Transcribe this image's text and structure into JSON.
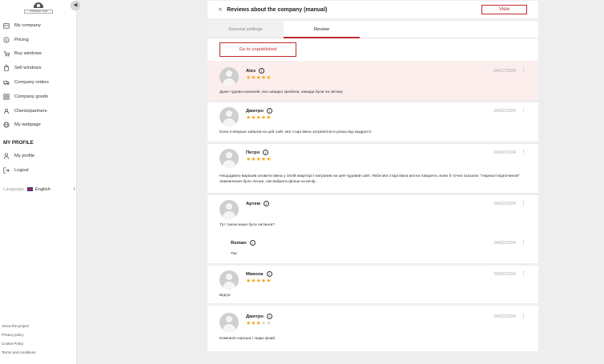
{
  "sidebar": {
    "logo_text": "FITRAVEK.COM",
    "items": [
      {
        "label": "My company",
        "icon": "building-icon"
      },
      {
        "label": "Pricing",
        "icon": "dollar-icon"
      },
      {
        "label": "Buy windows",
        "icon": "cart-icon"
      },
      {
        "label": "Sell windows",
        "icon": "bag-icon"
      },
      {
        "label": "Company orders",
        "icon": "truck-icon"
      },
      {
        "label": "Company goods",
        "icon": "grid-icon"
      },
      {
        "label": "Clients/partners",
        "icon": "users-icon"
      },
      {
        "label": "My webpage",
        "icon": "globe-icon"
      }
    ],
    "profile_title": "MY PROFILE",
    "profile_items": [
      {
        "label": "My profile",
        "icon": "user-icon"
      },
      {
        "label": "Logout",
        "icon": "logout-icon"
      }
    ],
    "language_label": "Language",
    "language_value": "English",
    "footer_links": [
      "About the project",
      "Privacy policy",
      "Cookie Policy",
      "Terms and conditions"
    ]
  },
  "header": {
    "title": "Reviews about the company (manual)",
    "view_label": "View"
  },
  "tabs": [
    {
      "label": "General settings",
      "active": false
    },
    {
      "label": "Review",
      "active": true
    }
  ],
  "unpublished_label": "Go to unpublished",
  "reviews": [
    {
      "author": "Alex",
      "rating": 5,
      "date": "04/07/2025",
      "text": "Дуже чудова компанія, все швидко зробили, завжди були на зв'язку",
      "highlight": true
    },
    {
      "author": "Дмитро",
      "rating": 5,
      "date": "06/02/2024",
      "text": "Коли я вперше зайшов на цей сайт, мої старі вікна затремтіли в роках від заздрості."
    },
    {
      "author": "Петро",
      "rating": 5,
      "date": "06/02/2024",
      "text": "Нещодавно вирішив оновити вікна у своїй квартирі і натрапив на цей чудовий сайт. Якби мої старі вікна могли говорити, вони б точно сказали: \"Нарешті відпочинок!\" Замовлення було легше, ніж вибрати фільм на вечір."
    },
    {
      "author": "Артем",
      "rating": 0,
      "date": "06/02/2024",
      "text": "Тут також може бути питання?",
      "reply": {
        "author": "Roman",
        "date": "06/02/2024",
        "text": "Так"
      }
    },
    {
      "author": "Микола",
      "rating": 5,
      "date": "06/02/2024",
      "text": "Відгук"
    },
    {
      "author": "Дмитро",
      "rating": 3,
      "date": "05/02/2024",
      "text": "Компанія хороша і люди цікаві."
    }
  ],
  "colors": {
    "accent": "#c0292d",
    "star": "#f5a623",
    "highlight": "#fdeeee"
  }
}
